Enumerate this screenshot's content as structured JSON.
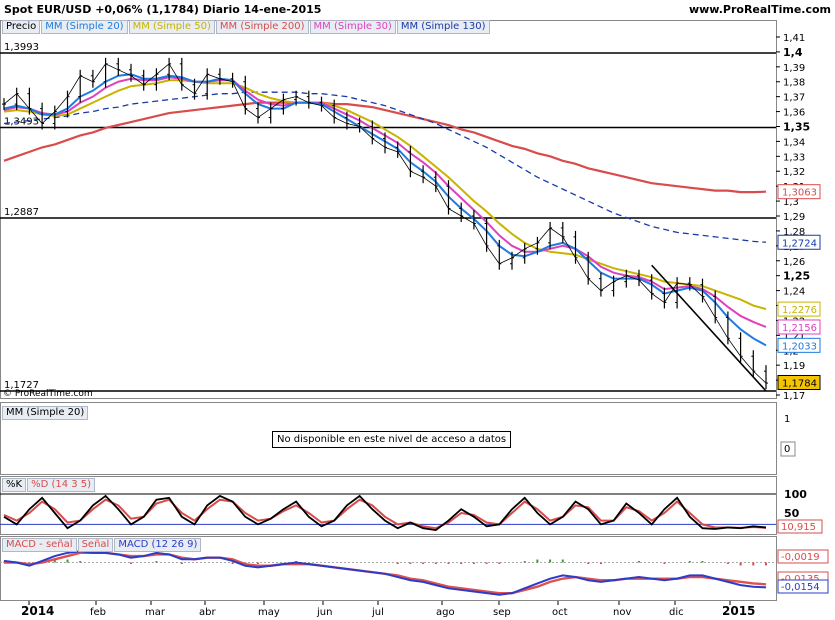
{
  "header": {
    "title": "Spot EUR/USD    +0,06% (1,1784)    Diario    14-ene-2015",
    "site": "www.ProRealTime.com"
  },
  "legend": {
    "precio": "Precio",
    "ma20": "MM (Simple 20)",
    "ma50": "MM (Simple 50)",
    "ma200": "MM (Simple 200)",
    "ma30": "MM (Simple 30)",
    "ma130": "MM (Simple 130)"
  },
  "copyright": "© ProRealTime.com",
  "panel2": {
    "legend": "MM (Simple 20)",
    "notice": "No disponible en este nivel de acceso a datos"
  },
  "panel3": {
    "legend_k": "%K",
    "legend_d": "%D (14 3 5)",
    "last_value": "10,915"
  },
  "panel4": {
    "legend_macd_signal": "MACD - señal",
    "legend_signal": "Señal",
    "legend_macd": "MACD (12 26 9)",
    "val_top": "-0,0019",
    "val_mid": "-0,0135",
    "val_bot": "-0,0154"
  },
  "colors": {
    "price": "#000000",
    "ma20": "#1e7be0",
    "ma50": "#c8b400",
    "ma200": "#d94c4c",
    "ma30": "#e040c0",
    "ma130": "#1a3aa8",
    "stoch_k": "#000000",
    "stoch_d": "#d94c4c",
    "macd": "#2b3cc8",
    "signal": "#e05050",
    "last_price_bg": "#f5c400"
  },
  "chart_data": {
    "type": "line",
    "title": "Spot EUR/USD Diario",
    "x_labels": [
      "2014",
      "feb",
      "mar",
      "abr",
      "may",
      "jun",
      "jul",
      "ago",
      "sep",
      "oct",
      "nov",
      "dic",
      "2015"
    ],
    "y_ticks": [
      "1,41",
      "1,4",
      "1,39",
      "1,38",
      "1,37",
      "1,36",
      "1,35",
      "1,34",
      "1,33",
      "1,32",
      "1,31",
      "1,3",
      "1,29",
      "1,28",
      "1,27",
      "1,26",
      "1,25",
      "1,24",
      "1,23",
      "1,22",
      "1,21",
      "1,2",
      "1,19",
      "1,18",
      "1,17"
    ],
    "ylim": [
      1.168,
      1.412
    ],
    "horizontal_lines": [
      {
        "label": "1,3993",
        "value": 1.3993
      },
      {
        "label": "1,3493",
        "value": 1.3493
      },
      {
        "label": "1,2887",
        "value": 1.2887
      },
      {
        "label": "1,1727",
        "value": 1.1727
      }
    ],
    "value_tags": [
      {
        "label": "1,3063",
        "value": 1.3063,
        "series": "ma200"
      },
      {
        "label": "1,2724",
        "value": 1.2724,
        "series": "ma130"
      },
      {
        "label": "1,2276",
        "value": 1.2276,
        "series": "ma50"
      },
      {
        "label": "1,2156",
        "value": 1.2156,
        "series": "ma30"
      },
      {
        "label": "1,2033",
        "value": 1.2033,
        "series": "ma20"
      },
      {
        "label": "1,1784",
        "value": 1.1784,
        "series": "price"
      }
    ],
    "series": [
      {
        "name": "Precio",
        "key": "price",
        "values": [
          1.365,
          1.372,
          1.362,
          1.352,
          1.36,
          1.37,
          1.384,
          1.38,
          1.392,
          1.388,
          1.384,
          1.378,
          1.385,
          1.392,
          1.378,
          1.372,
          1.385,
          1.382,
          1.38,
          1.362,
          1.356,
          1.362,
          1.368,
          1.37,
          1.366,
          1.364,
          1.356,
          1.352,
          1.35,
          1.342,
          1.336,
          1.333,
          1.32,
          1.316,
          1.31,
          1.295,
          1.29,
          1.285,
          1.27,
          1.258,
          1.262,
          1.268,
          1.272,
          1.282,
          1.276,
          1.262,
          1.248,
          1.24,
          1.246,
          1.25,
          1.247,
          1.238,
          1.232,
          1.245,
          1.244,
          1.236,
          1.222,
          1.208,
          1.196,
          1.186,
          1.178
        ]
      },
      {
        "name": "MM (Simple 20)",
        "key": "ma20",
        "values": [
          1.362,
          1.364,
          1.362,
          1.358,
          1.358,
          1.362,
          1.37,
          1.374,
          1.38,
          1.384,
          1.385,
          1.382,
          1.382,
          1.384,
          1.383,
          1.38,
          1.38,
          1.382,
          1.381,
          1.372,
          1.365,
          1.362,
          1.362,
          1.366,
          1.366,
          1.365,
          1.36,
          1.355,
          1.35,
          1.345,
          1.34,
          1.335,
          1.326,
          1.32,
          1.313,
          1.303,
          1.295,
          1.288,
          1.28,
          1.27,
          1.264,
          1.263,
          1.266,
          1.27,
          1.272,
          1.268,
          1.26,
          1.252,
          1.248,
          1.248,
          1.248,
          1.244,
          1.238,
          1.24,
          1.242,
          1.24,
          1.232,
          1.222,
          1.214,
          1.208,
          1.2033
        ]
      },
      {
        "name": "MM (Simple 50)",
        "key": "ma50",
        "values": [
          1.36,
          1.361,
          1.36,
          1.358,
          1.357,
          1.358,
          1.362,
          1.366,
          1.37,
          1.374,
          1.377,
          1.378,
          1.379,
          1.381,
          1.381,
          1.38,
          1.379,
          1.379,
          1.379,
          1.376,
          1.372,
          1.369,
          1.367,
          1.366,
          1.366,
          1.366,
          1.364,
          1.361,
          1.357,
          1.353,
          1.348,
          1.343,
          1.337,
          1.33,
          1.323,
          1.316,
          1.308,
          1.3,
          1.293,
          1.285,
          1.278,
          1.272,
          1.268,
          1.266,
          1.265,
          1.264,
          1.261,
          1.258,
          1.255,
          1.253,
          1.251,
          1.249,
          1.246,
          1.245,
          1.244,
          1.243,
          1.24,
          1.237,
          1.234,
          1.23,
          1.2276
        ]
      },
      {
        "name": "MM (Simple 30)",
        "key": "ma30",
        "values": [
          1.361,
          1.363,
          1.362,
          1.359,
          1.358,
          1.36,
          1.366,
          1.37,
          1.376,
          1.38,
          1.382,
          1.381,
          1.381,
          1.383,
          1.382,
          1.38,
          1.38,
          1.381,
          1.381,
          1.374,
          1.368,
          1.365,
          1.364,
          1.366,
          1.366,
          1.366,
          1.362,
          1.358,
          1.354,
          1.349,
          1.344,
          1.339,
          1.332,
          1.326,
          1.319,
          1.31,
          1.302,
          1.294,
          1.286,
          1.277,
          1.27,
          1.266,
          1.266,
          1.268,
          1.27,
          1.268,
          1.263,
          1.256,
          1.252,
          1.25,
          1.249,
          1.246,
          1.241,
          1.242,
          1.243,
          1.241,
          1.236,
          1.229,
          1.223,
          1.219,
          1.2156
        ]
      },
      {
        "name": "MM (Simple 200)",
        "key": "ma200",
        "values": [
          1.327,
          1.33,
          1.333,
          1.336,
          1.338,
          1.341,
          1.344,
          1.346,
          1.349,
          1.351,
          1.353,
          1.355,
          1.357,
          1.359,
          1.36,
          1.361,
          1.362,
          1.363,
          1.364,
          1.365,
          1.366,
          1.366,
          1.366,
          1.366,
          1.366,
          1.366,
          1.365,
          1.365,
          1.364,
          1.363,
          1.361,
          1.359,
          1.357,
          1.355,
          1.353,
          1.351,
          1.348,
          1.346,
          1.343,
          1.34,
          1.337,
          1.335,
          1.332,
          1.33,
          1.327,
          1.325,
          1.322,
          1.32,
          1.318,
          1.316,
          1.314,
          1.312,
          1.311,
          1.31,
          1.309,
          1.308,
          1.307,
          1.307,
          1.306,
          1.306,
          1.3063
        ]
      },
      {
        "name": "MM (Simple 130)",
        "key": "ma130",
        "values": [
          1.352,
          1.353,
          1.354,
          1.355,
          1.356,
          1.357,
          1.359,
          1.36,
          1.362,
          1.363,
          1.365,
          1.366,
          1.367,
          1.368,
          1.369,
          1.37,
          1.371,
          1.372,
          1.372,
          1.373,
          1.373,
          1.373,
          1.373,
          1.373,
          1.372,
          1.372,
          1.371,
          1.37,
          1.368,
          1.366,
          1.364,
          1.361,
          1.358,
          1.355,
          1.352,
          1.348,
          1.344,
          1.34,
          1.336,
          1.331,
          1.326,
          1.321,
          1.316,
          1.312,
          1.308,
          1.304,
          1.3,
          1.296,
          1.292,
          1.289,
          1.286,
          1.283,
          1.281,
          1.279,
          1.278,
          1.277,
          1.276,
          1.275,
          1.274,
          1.273,
          1.2724
        ]
      }
    ],
    "stochastic": {
      "ticks": [
        "100",
        "50"
      ],
      "k": [
        40,
        20,
        60,
        90,
        50,
        10,
        30,
        70,
        95,
        60,
        20,
        40,
        85,
        90,
        40,
        20,
        70,
        95,
        80,
        40,
        20,
        35,
        60,
        80,
        40,
        15,
        30,
        70,
        95,
        60,
        30,
        10,
        25,
        10,
        5,
        30,
        60,
        40,
        15,
        20,
        60,
        90,
        50,
        20,
        40,
        80,
        60,
        20,
        30,
        75,
        50,
        20,
        60,
        90,
        40,
        10,
        8,
        12,
        10,
        15,
        12
      ],
      "d": [
        45,
        30,
        50,
        80,
        60,
        25,
        30,
        60,
        85,
        70,
        35,
        40,
        75,
        85,
        50,
        30,
        60,
        85,
        80,
        50,
        30,
        35,
        55,
        70,
        50,
        25,
        30,
        60,
        85,
        70,
        40,
        20,
        25,
        15,
        10,
        25,
        50,
        45,
        25,
        20,
        50,
        80,
        60,
        30,
        40,
        70,
        65,
        30,
        30,
        65,
        55,
        30,
        50,
        80,
        50,
        20,
        12,
        12,
        11,
        13,
        10.915
      ]
    },
    "macd": {
      "macd": [
        0.001,
        0.0,
        -0.002,
        0.001,
        0.004,
        0.006,
        0.007,
        0.006,
        0.006,
        0.005,
        0.003,
        0.004,
        0.006,
        0.005,
        0.002,
        0.002,
        0.003,
        0.003,
        0.001,
        -0.002,
        -0.003,
        -0.002,
        -0.001,
        0.0,
        -0.001,
        -0.002,
        -0.003,
        -0.004,
        -0.005,
        -0.006,
        -0.007,
        -0.009,
        -0.011,
        -0.012,
        -0.014,
        -0.016,
        -0.017,
        -0.018,
        -0.019,
        -0.02,
        -0.019,
        -0.016,
        -0.013,
        -0.01,
        -0.008,
        -0.009,
        -0.011,
        -0.012,
        -0.011,
        -0.01,
        -0.009,
        -0.01,
        -0.011,
        -0.01,
        -0.008,
        -0.008,
        -0.01,
        -0.012,
        -0.014,
        -0.015,
        -0.0154
      ],
      "signal": [
        0.0,
        0.0,
        -0.001,
        0.0,
        0.002,
        0.004,
        0.006,
        0.006,
        0.006,
        0.005,
        0.004,
        0.004,
        0.005,
        0.005,
        0.003,
        0.002,
        0.003,
        0.003,
        0.002,
        -0.001,
        -0.002,
        -0.002,
        -0.001,
        -0.001,
        -0.001,
        -0.002,
        -0.003,
        -0.004,
        -0.005,
        -0.006,
        -0.007,
        -0.008,
        -0.01,
        -0.011,
        -0.013,
        -0.015,
        -0.016,
        -0.017,
        -0.018,
        -0.019,
        -0.019,
        -0.017,
        -0.015,
        -0.012,
        -0.01,
        -0.009,
        -0.01,
        -0.011,
        -0.011,
        -0.01,
        -0.01,
        -0.01,
        -0.01,
        -0.01,
        -0.009,
        -0.009,
        -0.01,
        -0.011,
        -0.012,
        -0.013,
        -0.0135
      ],
      "hist": [
        0.0005,
        0,
        -0.001,
        0.001,
        0.002,
        0.002,
        0.001,
        0,
        0,
        0,
        -0.001,
        0,
        0.001,
        0,
        -0.001,
        0,
        0,
        0,
        -0.001,
        -0.001,
        -0.001,
        0,
        0,
        0.001,
        0,
        0,
        0,
        0,
        0,
        0,
        0,
        -0.001,
        -0.001,
        -0.001,
        -0.001,
        -0.001,
        -0.001,
        -0.001,
        -0.001,
        -0.001,
        0,
        0.001,
        0.002,
        0.002,
        0.002,
        0,
        -0.001,
        -0.001,
        0,
        0,
        0.001,
        0,
        -0.001,
        0,
        0.001,
        0.001,
        0,
        -0.001,
        -0.002,
        -0.002,
        -0.0019
      ]
    }
  }
}
